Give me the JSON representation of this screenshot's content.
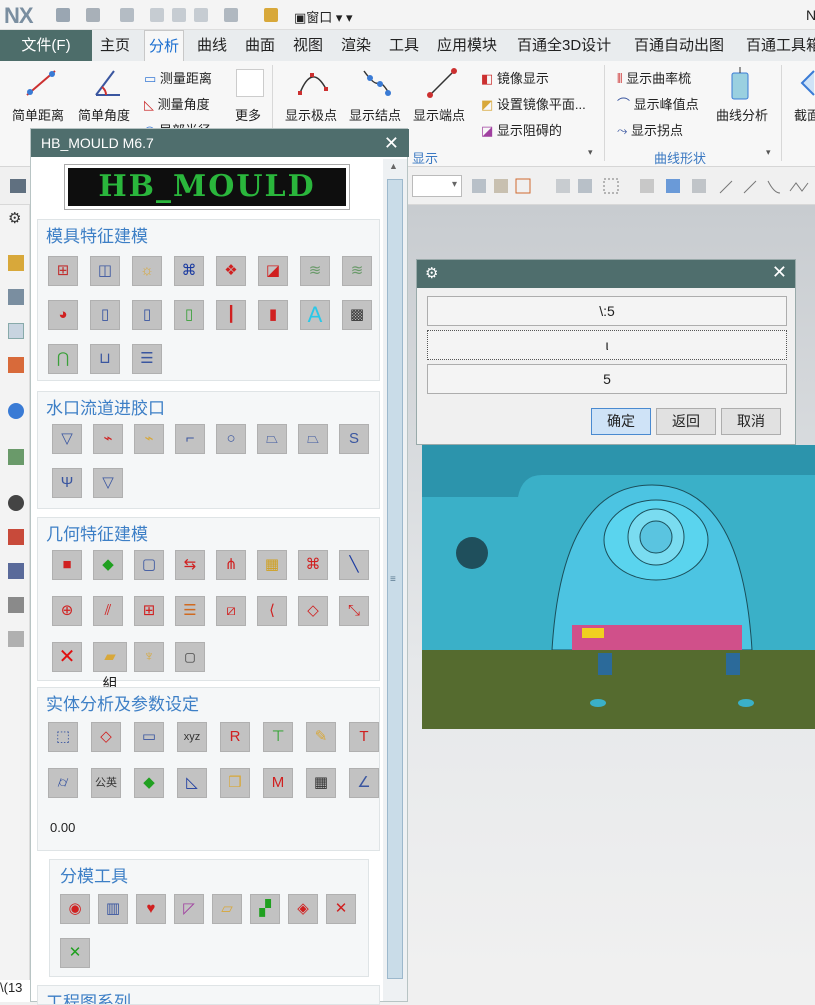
{
  "title": {
    "app": "NX",
    "window_menu": "窗口",
    "right_text": "N"
  },
  "menu": {
    "file": "文件(F)",
    "items": [
      "主页",
      "分析",
      "曲线",
      "曲面",
      "视图",
      "渲染",
      "工具",
      "应用模块",
      "百通全3D设计",
      "百通自动出图",
      "百通工具箱"
    ]
  },
  "ribbon": {
    "simple_distance": "简单距离",
    "simple_angle": "简单角度",
    "measure_distance": "测量距离",
    "measure_angle": "测量角度",
    "local_radius": "局部半径",
    "more": "更多",
    "show_poles": "显示极点",
    "show_knots": "显示结点",
    "show_endpoints": "显示端点",
    "mirror_display": "镜像显示",
    "set_mirror_plane": "设置镜像平面...",
    "show_blocked": "显示阻碍的",
    "group_display": "显示",
    "curvature_comb": "显示曲率梳",
    "show_peak": "显示峰值点",
    "show_inflection": "显示拐点",
    "curve_analysis": "曲线分析",
    "group_curve_shape": "曲线形状",
    "section": "截面"
  },
  "hb_panel": {
    "title": "HB_MOULD M6.7",
    "banner": "HB_MOULD",
    "sections": [
      {
        "title": "模具特征建模"
      },
      {
        "title": "水口流道进胶口"
      },
      {
        "title": "几何特征建模"
      },
      {
        "title": "实体分析及参数设定",
        "value": "0.00"
      },
      {
        "title": "分模工具"
      },
      {
        "title": "工程图系列"
      }
    ],
    "group_label": "組"
  },
  "dialog": {
    "field1": "\\:5",
    "field2": "ι",
    "field3": "5",
    "ok": "确定",
    "back": "返回",
    "cancel": "取消"
  },
  "status": {
    "left_text": "\\(13"
  },
  "colors": {
    "teal_header": "#4f6e6d",
    "accent_blue": "#3d7fc6",
    "file_menu": "#4d6d6a",
    "model_cyan": "#3ab0c8",
    "model_green": "#556b2f"
  }
}
